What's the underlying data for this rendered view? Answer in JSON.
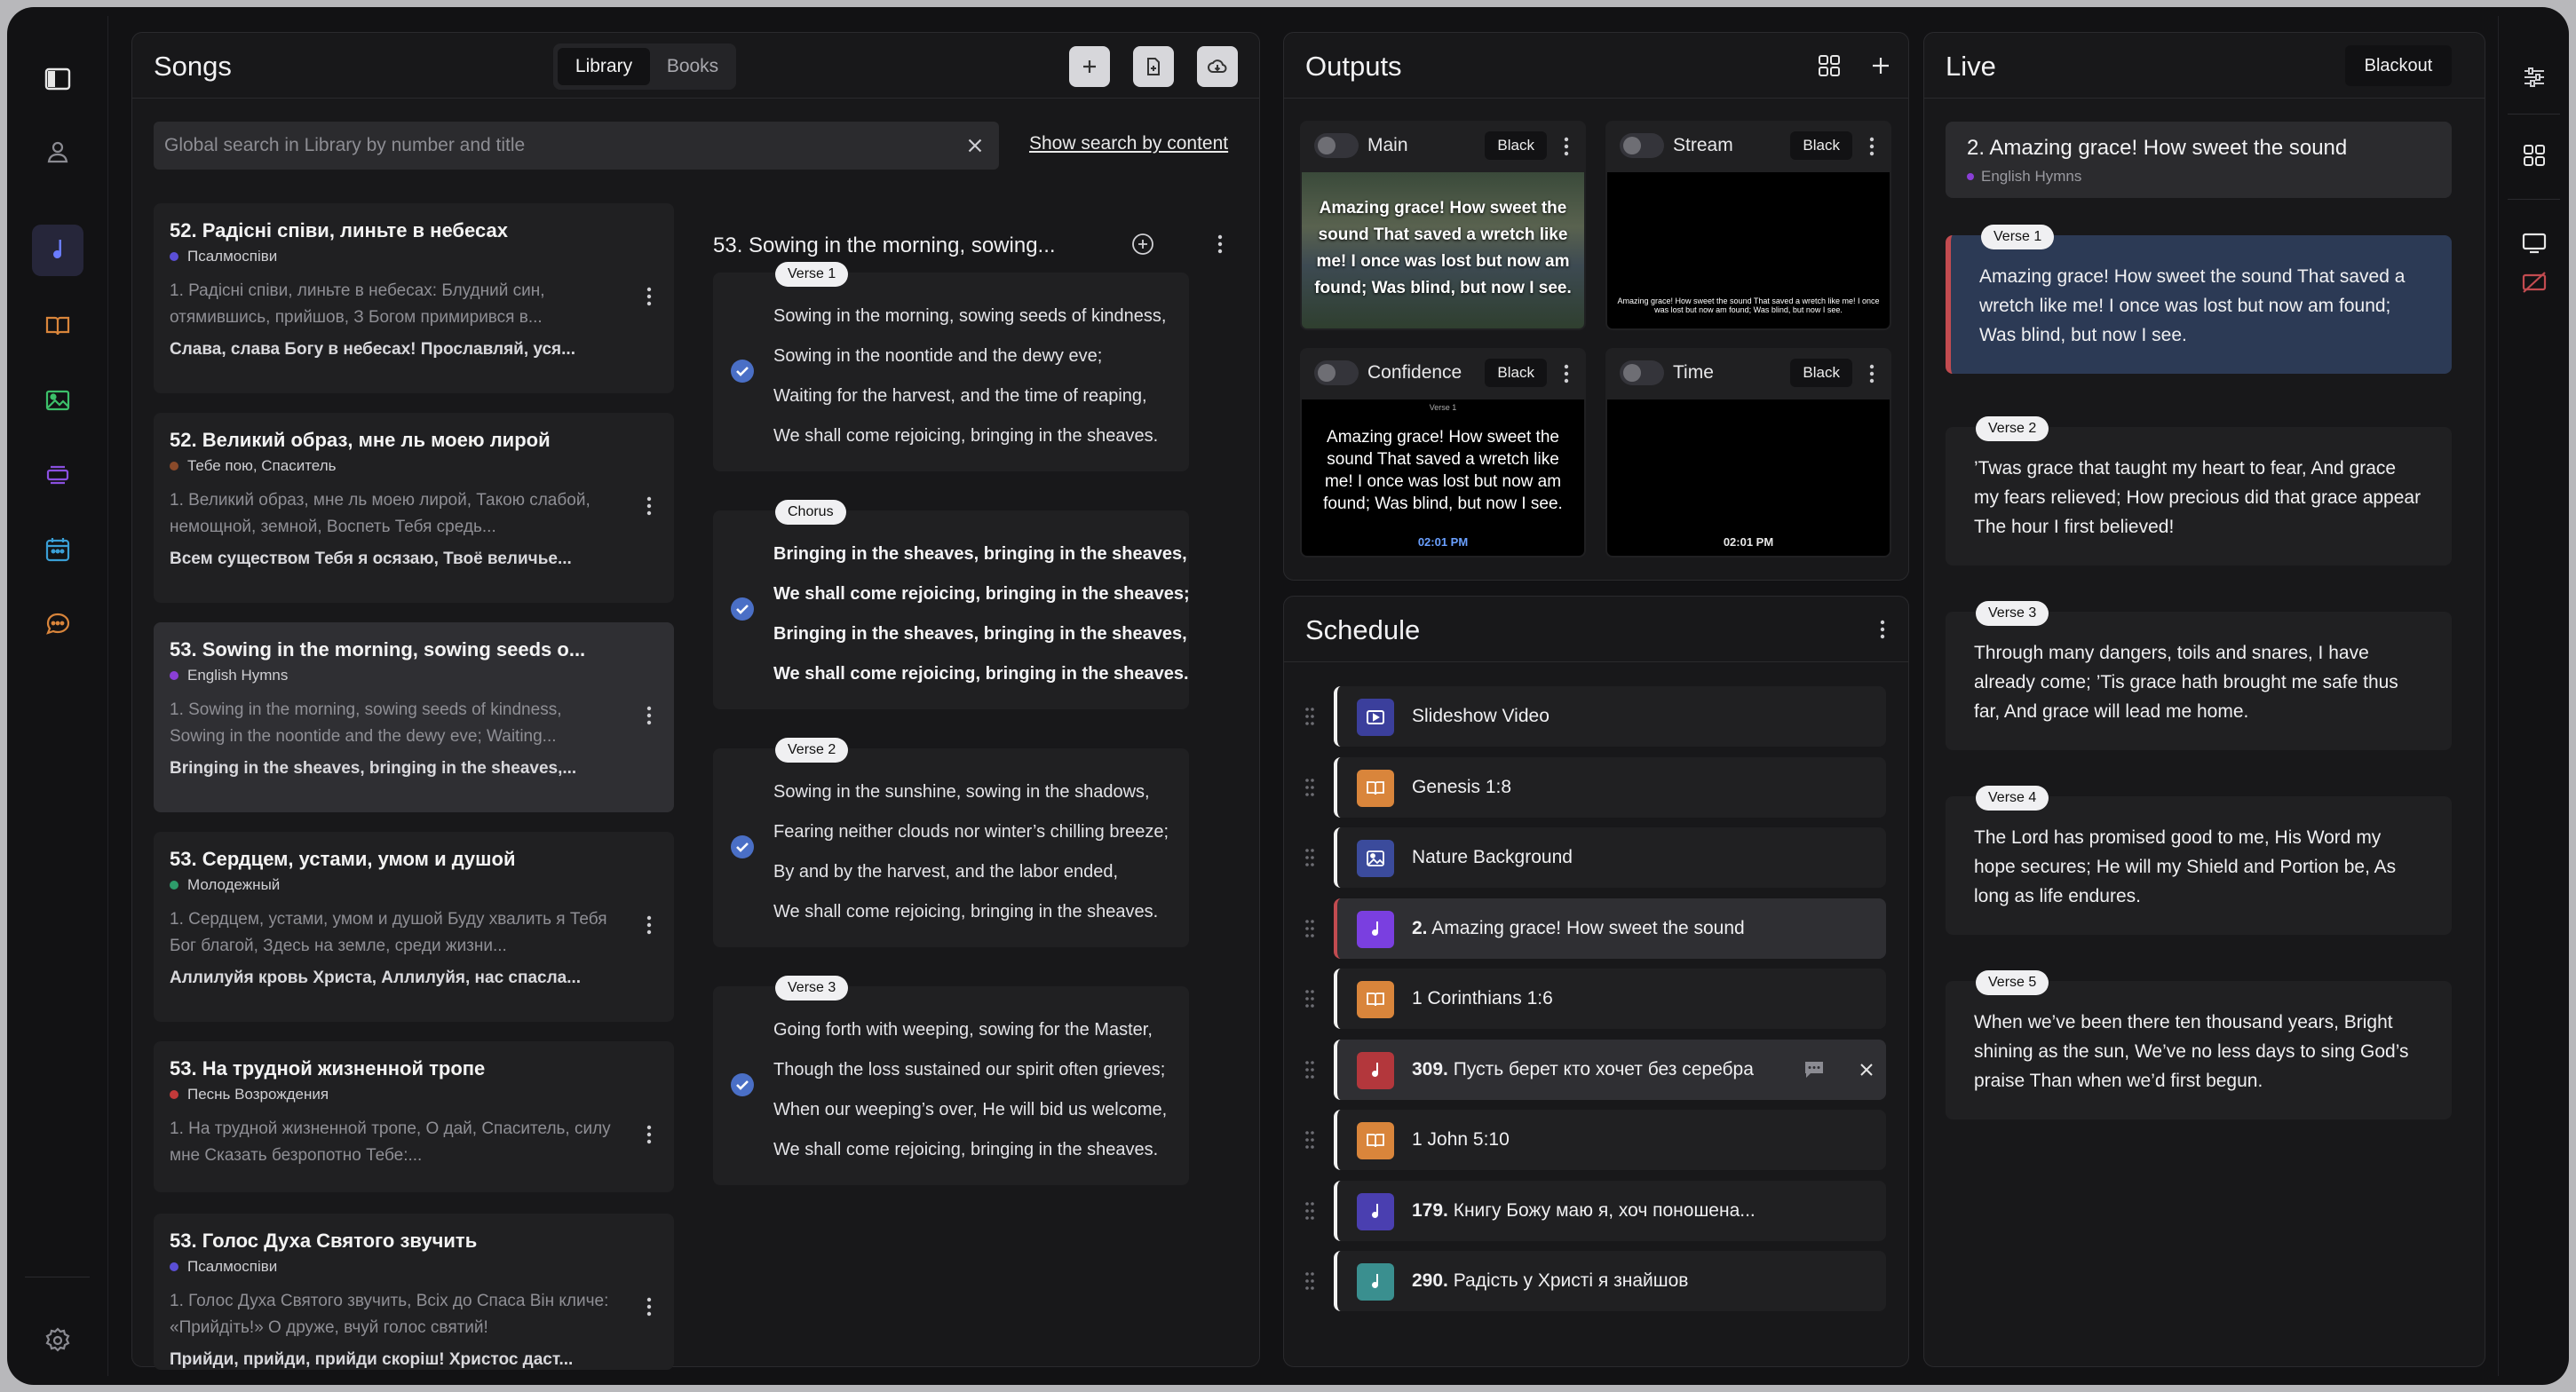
{
  "colors": {
    "accent": "#6a5cff",
    "live_bar": "#c24b50",
    "check": "#4a6fc6"
  },
  "rail": {
    "left": [
      {
        "name": "sidebar-toggle-icon"
      },
      {
        "name": "user-icon"
      },
      {
        "name": "music-note-icon"
      },
      {
        "name": "book-icon"
      },
      {
        "name": "image-icon"
      },
      {
        "name": "stack-icon"
      },
      {
        "name": "calendar-icon"
      },
      {
        "name": "chat-icon"
      },
      {
        "name": "settings-gear-icon"
      }
    ],
    "right": [
      {
        "name": "sliders-icon"
      },
      {
        "name": "grid-icon"
      },
      {
        "name": "monitor-icon"
      },
      {
        "name": "monitor-off-icon"
      }
    ]
  },
  "songs": {
    "title": "Songs",
    "tabs": [
      {
        "label": "Library",
        "active": true
      },
      {
        "label": "Books",
        "active": false
      }
    ],
    "search_placeholder": "Global search in Library by number and title",
    "show_search": "Show search by content",
    "list": [
      {
        "title": "52. Радісні співи, линьте в небесах",
        "book": "Псалмоспіви",
        "book_color": "#5b4fd6",
        "excerpt": "1. Радісні співи, линьте в небесах: Блудний син, отямившись, прийшов, З Богом примирився в...",
        "chorus": "Слава, слава Богу в небесах! Прославляй, уся..."
      },
      {
        "title": "52. Великий образ, мне ль моею лирой",
        "book": "Тебе пою, Спаситель",
        "book_color": "#8a4a2a",
        "excerpt": "1. Великий образ, мне ль моею лирой, Такою слабой, немощной, земной, Воспеть Тебя средь...",
        "chorus": "Всем существом Тебя я осязаю, Твоё величье..."
      },
      {
        "title": "53. Sowing in the morning, sowing seeds o...",
        "book": "English Hymns",
        "book_color": "#8a3fd6",
        "excerpt": "1. Sowing in the morning, sowing seeds of kindness, Sowing in the noontide and the dewy eve; Waiting...",
        "chorus": "Bringing in the sheaves, bringing in the sheaves,..."
      },
      {
        "title": "53. Сердцем, устами, умом и душой",
        "book": "Молодежный",
        "book_color": "#2e9c6b",
        "excerpt": "1. Сердцем, устами, умом и душой Буду хвалить я Тебя Бог благой, Здесь на земле, среди жизни...",
        "chorus": "Аллилуйя кровь Христа, Аллилуйя, нас спасла..."
      },
      {
        "title": "53. На трудной жизненной тропе",
        "book": "Песнь Возрождения",
        "book_color": "#c23a3a",
        "excerpt": "1. На трудной жизненной тропе, О дай, Спаситель, силу мне Сказать безропотно Тебе:...",
        "chorus": ""
      },
      {
        "title": "53. Голос Духа Святого звучить",
        "book": "Псалмоспіви",
        "book_color": "#5b4fd6",
        "excerpt": "1. Голос Духа Святого звучить, Всіх до Спаса Він кличе: «Прийдіть!» О друже, вчуй голос святий!",
        "chorus": "Прийди, прийди, прийди скоріш! Христос даст..."
      }
    ],
    "detail": {
      "title": "53. Sowing in the morning, sowing...",
      "verses": [
        {
          "tag": "Verse 1",
          "bold": false,
          "lines": [
            "Sowing in the morning, sowing seeds of kindness,",
            "Sowing in the noontide and the dewy eve;",
            "Waiting for the harvest, and the time of reaping,",
            "We shall come rejoicing, bringing in the sheaves."
          ]
        },
        {
          "tag": "Chorus",
          "bold": true,
          "lines": [
            "Bringing in the sheaves, bringing in the sheaves,",
            "We shall come rejoicing, bringing in the sheaves;",
            "Bringing in the sheaves, bringing in the sheaves,",
            "We shall come rejoicing, bringing in the sheaves."
          ]
        },
        {
          "tag": "Verse 2",
          "bold": false,
          "lines": [
            "Sowing in the sunshine, sowing in the shadows,",
            "Fearing neither clouds nor winter’s chilling breeze;",
            "By and by the harvest, and the labor ended,",
            "We shall come rejoicing, bringing in the sheaves."
          ]
        },
        {
          "tag": "Verse 3",
          "bold": false,
          "lines": [
            "Going forth with weeping, sowing for the Master,",
            "Though the loss sustained our spirit often grieves;",
            "When our weeping’s over, He will bid us welcome,",
            "We shall come rejoicing, bringing in the sheaves."
          ]
        }
      ]
    }
  },
  "outputs": {
    "title": "Outputs",
    "cards": [
      {
        "name": "Main",
        "black": "Black",
        "text": "Amazing grace! How sweet the sound That saved a wretch like me! I once was lost but now am found; Was blind, but now I see.",
        "time": ""
      },
      {
        "name": "Stream",
        "black": "Black",
        "text": "Amazing grace! How sweet the sound That saved a wretch like me! I once was lost but now am found; Was blind, but now I see.",
        "time": ""
      },
      {
        "name": "Confidence",
        "black": "Black",
        "label": "Verse 1",
        "text": "Amazing grace! How sweet the sound That saved a wretch like me! I once was lost but now am found; Was blind, but now I see.",
        "time": "02:01 PM"
      },
      {
        "name": "Time",
        "black": "Black",
        "text": "",
        "time": "02:01 PM"
      }
    ]
  },
  "schedule": {
    "title": "Schedule",
    "items": [
      {
        "num": "",
        "label": "Slideshow Video",
        "icon": "video-icon",
        "color": "#3b3f9c"
      },
      {
        "num": "",
        "label": "Genesis 1:8",
        "icon": "book-icon",
        "color": "#d9853b"
      },
      {
        "num": "",
        "label": "Nature Background",
        "icon": "image-icon",
        "color": "#3b4b9c"
      },
      {
        "num": "2.",
        "label": "Amazing grace! How sweet the sound",
        "icon": "music-note-icon",
        "color": "#7a3fe0"
      },
      {
        "num": "",
        "label": "1 Corinthians 1:6",
        "icon": "book-icon",
        "color": "#d9853b"
      },
      {
        "num": "309.",
        "label": "Пусть берет кто хочет без серебра",
        "icon": "music-note-icon",
        "color": "#b3373c"
      },
      {
        "num": "",
        "label": "1 John 5:10",
        "icon": "book-icon",
        "color": "#d9853b"
      },
      {
        "num": "179.",
        "label": "Книгу Божу маю я, хоч поношена...",
        "icon": "music-note-icon",
        "color": "#4a3fb0"
      },
      {
        "num": "290.",
        "label": "Радість у Христі я знайшов",
        "icon": "music-note-icon",
        "color": "#3a8f8f"
      }
    ]
  },
  "live": {
    "title": "Live",
    "blackout": "Blackout",
    "current_title": "2. Amazing grace! How sweet the sound",
    "current_book": "English Hymns",
    "verses": [
      {
        "tag": "Verse 1",
        "text": "Amazing grace! How sweet the sound That saved a wretch like me! I once was lost but now am found; Was blind, but now I see."
      },
      {
        "tag": "Verse 2",
        "text": "’Twas grace that taught my heart to fear, And grace my fears relieved; How precious did that grace appear The hour I first believed!"
      },
      {
        "tag": "Verse 3",
        "text": "Through many dangers, toils and snares, I have already come; ’Tis grace hath brought me safe thus far, And grace will lead me home."
      },
      {
        "tag": "Verse 4",
        "text": "The Lord has promised good to me, His Word my hope secures; He will my Shield and Portion be, As long as life endures."
      },
      {
        "tag": "Verse 5",
        "text": "When we’ve been there ten thousand years, Bright shining as the sun, We’ve no less days to sing God’s praise Than when we’d first begun."
      }
    ]
  }
}
